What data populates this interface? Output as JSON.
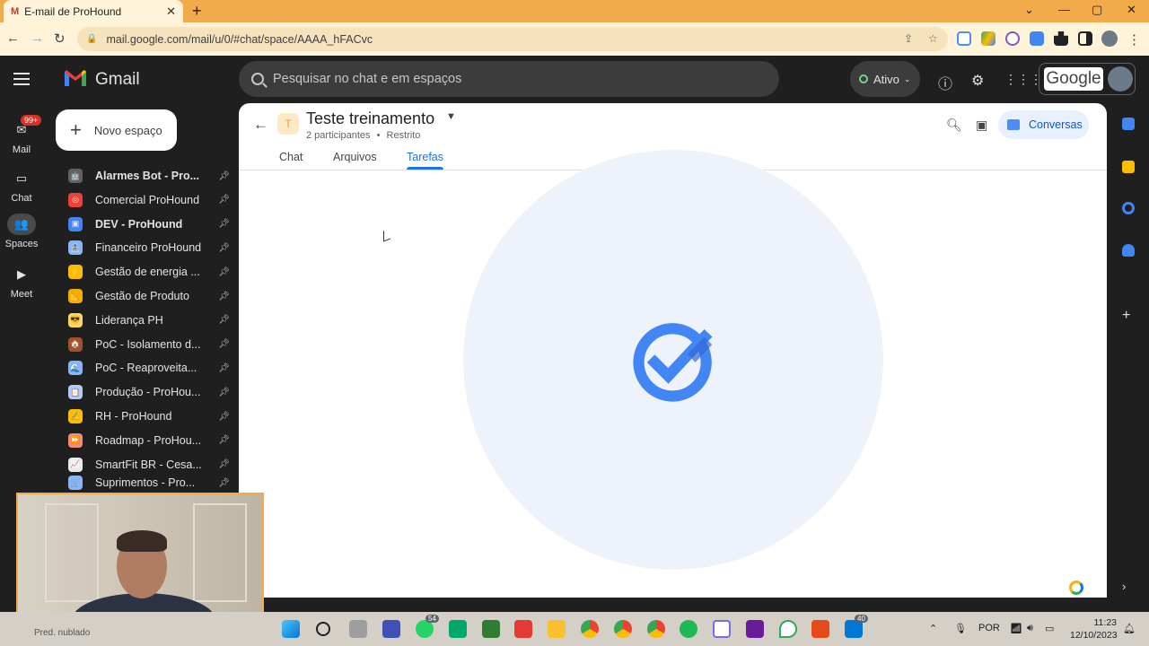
{
  "browser": {
    "tab_title": "E-mail de ProHound",
    "favicon": "M",
    "tab_close": "✕",
    "new_tab": "+",
    "url": "mail.google.com/mail/u/0/#chat/space/AAAA_hFACvc",
    "win_min": "—",
    "win_max": "▢",
    "win_close": "✕",
    "win_menu": "⌄"
  },
  "gmail": {
    "brand": "Gmail",
    "search_placeholder": "Pesquisar no chat e em espaços",
    "status": "Ativo",
    "google_label": "Google",
    "compose_label": "Novo espaço"
  },
  "rail": {
    "mail": "Mail",
    "mail_badge": "99+",
    "chat": "Chat",
    "spaces": "Spaces",
    "meet": "Meet"
  },
  "spaces": [
    {
      "name": "Alarmes Bot - Pro...",
      "bold": true,
      "color": "#5f6368",
      "icon": "🤖"
    },
    {
      "name": "Comercial ProHound",
      "bold": false,
      "color": "#ea4335",
      "icon": "◎"
    },
    {
      "name": "DEV - ProHound",
      "bold": true,
      "color": "#4285f4",
      "icon": "▣"
    },
    {
      "name": "Financeiro ProHound",
      "bold": false,
      "color": "#8ab4f8",
      "icon": "🏦"
    },
    {
      "name": "Gestão de energia ...",
      "bold": false,
      "color": "#fbbc04",
      "icon": "⚡"
    },
    {
      "name": "Gestão de Produto",
      "bold": false,
      "color": "#f9ab00",
      "icon": "📐"
    },
    {
      "name": "Liderança PH",
      "bold": false,
      "color": "#fdd663",
      "icon": "😎"
    },
    {
      "name": "PoC - Isolamento d...",
      "bold": false,
      "color": "#a0522d",
      "icon": "🏠"
    },
    {
      "name": "PoC - Reaproveita...",
      "bold": false,
      "color": "#8ab4f8",
      "icon": "🌊"
    },
    {
      "name": "Produção - ProHou...",
      "bold": false,
      "color": "#aecbfa",
      "icon": "📋"
    },
    {
      "name": "RH - ProHound",
      "bold": false,
      "color": "#fbbc04",
      "icon": "✍"
    },
    {
      "name": "Roadmap - ProHou...",
      "bold": false,
      "color": "#f28b82",
      "icon": "⏩"
    },
    {
      "name": "SmartFit BR - Cesa...",
      "bold": false,
      "color": "#e8eaed",
      "icon": "📈"
    },
    {
      "name": "Suprimentos - Pro...",
      "bold": false,
      "color": "#8ab4f8",
      "icon": "🛒"
    }
  ],
  "main": {
    "space_initial": "T",
    "space_title": "Teste treinamento",
    "participants": "2 participantes",
    "separator": "•",
    "access": "Restrito",
    "tabs": [
      "Chat",
      "Arquivos",
      "Tarefas"
    ],
    "active_tab": "Tarefas",
    "conversations_button": "Conversas"
  },
  "taskbar": {
    "whatsapp_badge": "54",
    "mail_badge": "40",
    "lang": "POR",
    "time": "11:23",
    "date": "12/10/2023",
    "weather": "Pred. nublado"
  },
  "colors": {
    "accent": "#1a73e8",
    "titlebar": "#f2ab4b",
    "toolbar": "#fff3d9",
    "dark_bg": "#1f1f1f"
  }
}
